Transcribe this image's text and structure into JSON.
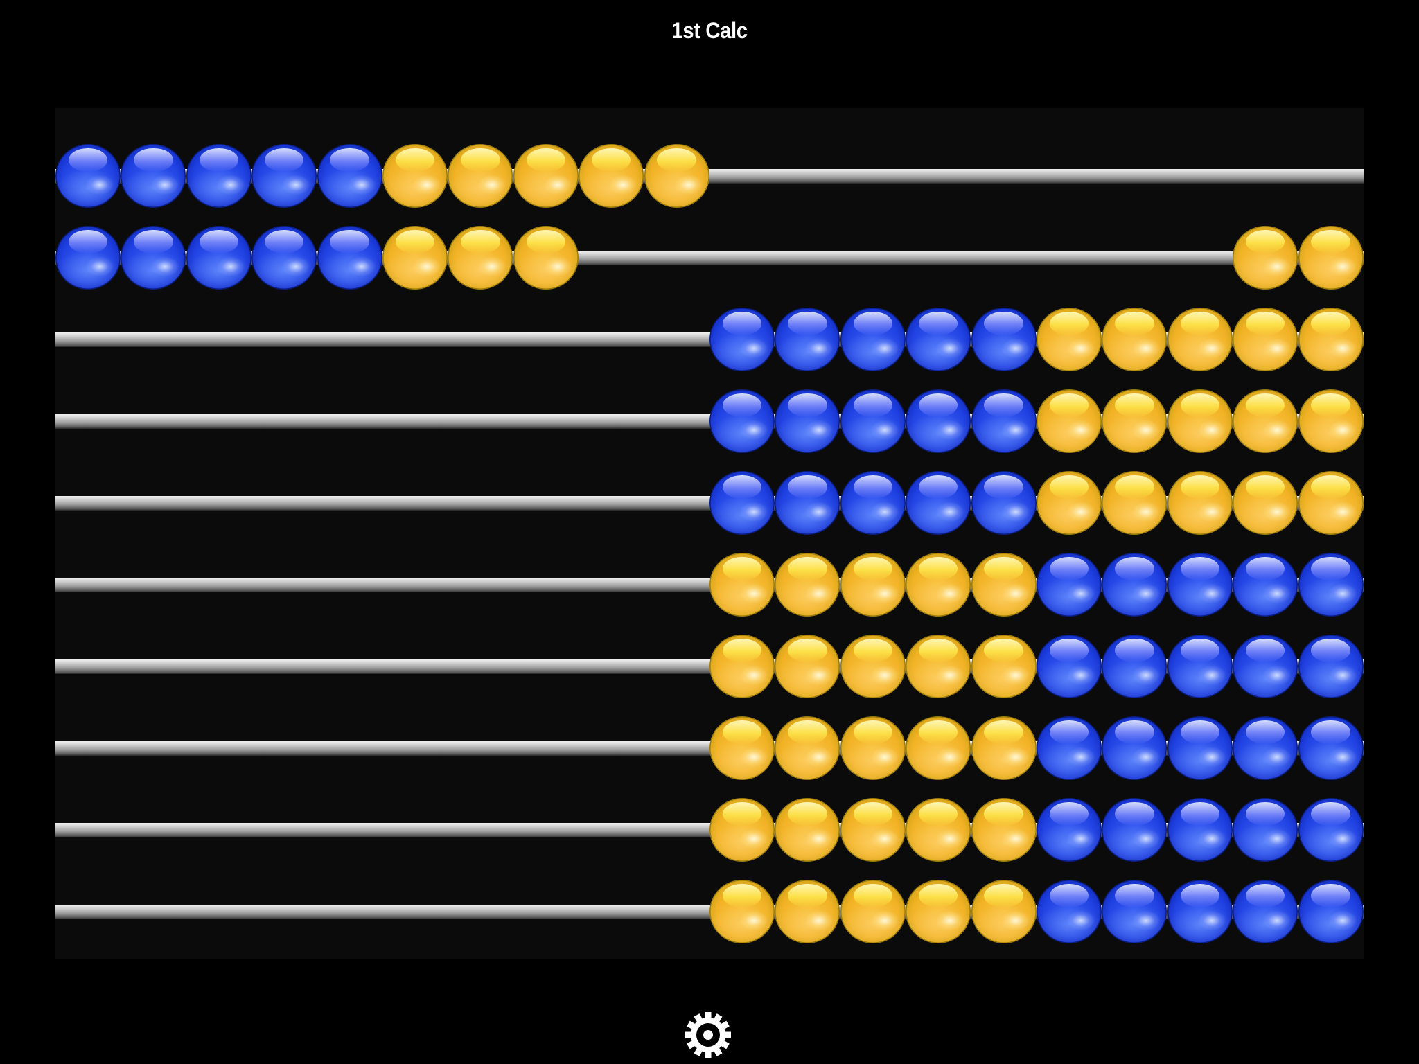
{
  "header": {
    "title": "1st Calc"
  },
  "abacus": {
    "beads_per_rod": 10,
    "colors": {
      "blue": "#1d3fe0",
      "yellow": "#f0b022",
      "rod": "#c8c8c8",
      "frame": "#0b0b0b",
      "background": "#000000"
    },
    "rods": [
      {
        "left_count": 10,
        "right_count": 0,
        "pattern": [
          "blue",
          "blue",
          "blue",
          "blue",
          "blue",
          "yellow",
          "yellow",
          "yellow",
          "yellow",
          "yellow"
        ]
      },
      {
        "left_count": 8,
        "right_count": 2,
        "pattern": [
          "blue",
          "blue",
          "blue",
          "blue",
          "blue",
          "yellow",
          "yellow",
          "yellow",
          "yellow",
          "yellow"
        ]
      },
      {
        "left_count": 0,
        "right_count": 10,
        "pattern": [
          "blue",
          "blue",
          "blue",
          "blue",
          "blue",
          "yellow",
          "yellow",
          "yellow",
          "yellow",
          "yellow"
        ]
      },
      {
        "left_count": 0,
        "right_count": 10,
        "pattern": [
          "blue",
          "blue",
          "blue",
          "blue",
          "blue",
          "yellow",
          "yellow",
          "yellow",
          "yellow",
          "yellow"
        ]
      },
      {
        "left_count": 0,
        "right_count": 10,
        "pattern": [
          "blue",
          "blue",
          "blue",
          "blue",
          "blue",
          "yellow",
          "yellow",
          "yellow",
          "yellow",
          "yellow"
        ]
      },
      {
        "left_count": 0,
        "right_count": 10,
        "pattern": [
          "yellow",
          "yellow",
          "yellow",
          "yellow",
          "yellow",
          "blue",
          "blue",
          "blue",
          "blue",
          "blue"
        ]
      },
      {
        "left_count": 0,
        "right_count": 10,
        "pattern": [
          "yellow",
          "yellow",
          "yellow",
          "yellow",
          "yellow",
          "blue",
          "blue",
          "blue",
          "blue",
          "blue"
        ]
      },
      {
        "left_count": 0,
        "right_count": 10,
        "pattern": [
          "yellow",
          "yellow",
          "yellow",
          "yellow",
          "yellow",
          "blue",
          "blue",
          "blue",
          "blue",
          "blue"
        ]
      },
      {
        "left_count": 0,
        "right_count": 10,
        "pattern": [
          "yellow",
          "yellow",
          "yellow",
          "yellow",
          "yellow",
          "blue",
          "blue",
          "blue",
          "blue",
          "blue"
        ]
      },
      {
        "left_count": 0,
        "right_count": 10,
        "pattern": [
          "yellow",
          "yellow",
          "yellow",
          "yellow",
          "yellow",
          "blue",
          "blue",
          "blue",
          "blue",
          "blue"
        ]
      }
    ],
    "counted_total": 18
  },
  "footer": {
    "settings_icon": "gear-icon"
  }
}
